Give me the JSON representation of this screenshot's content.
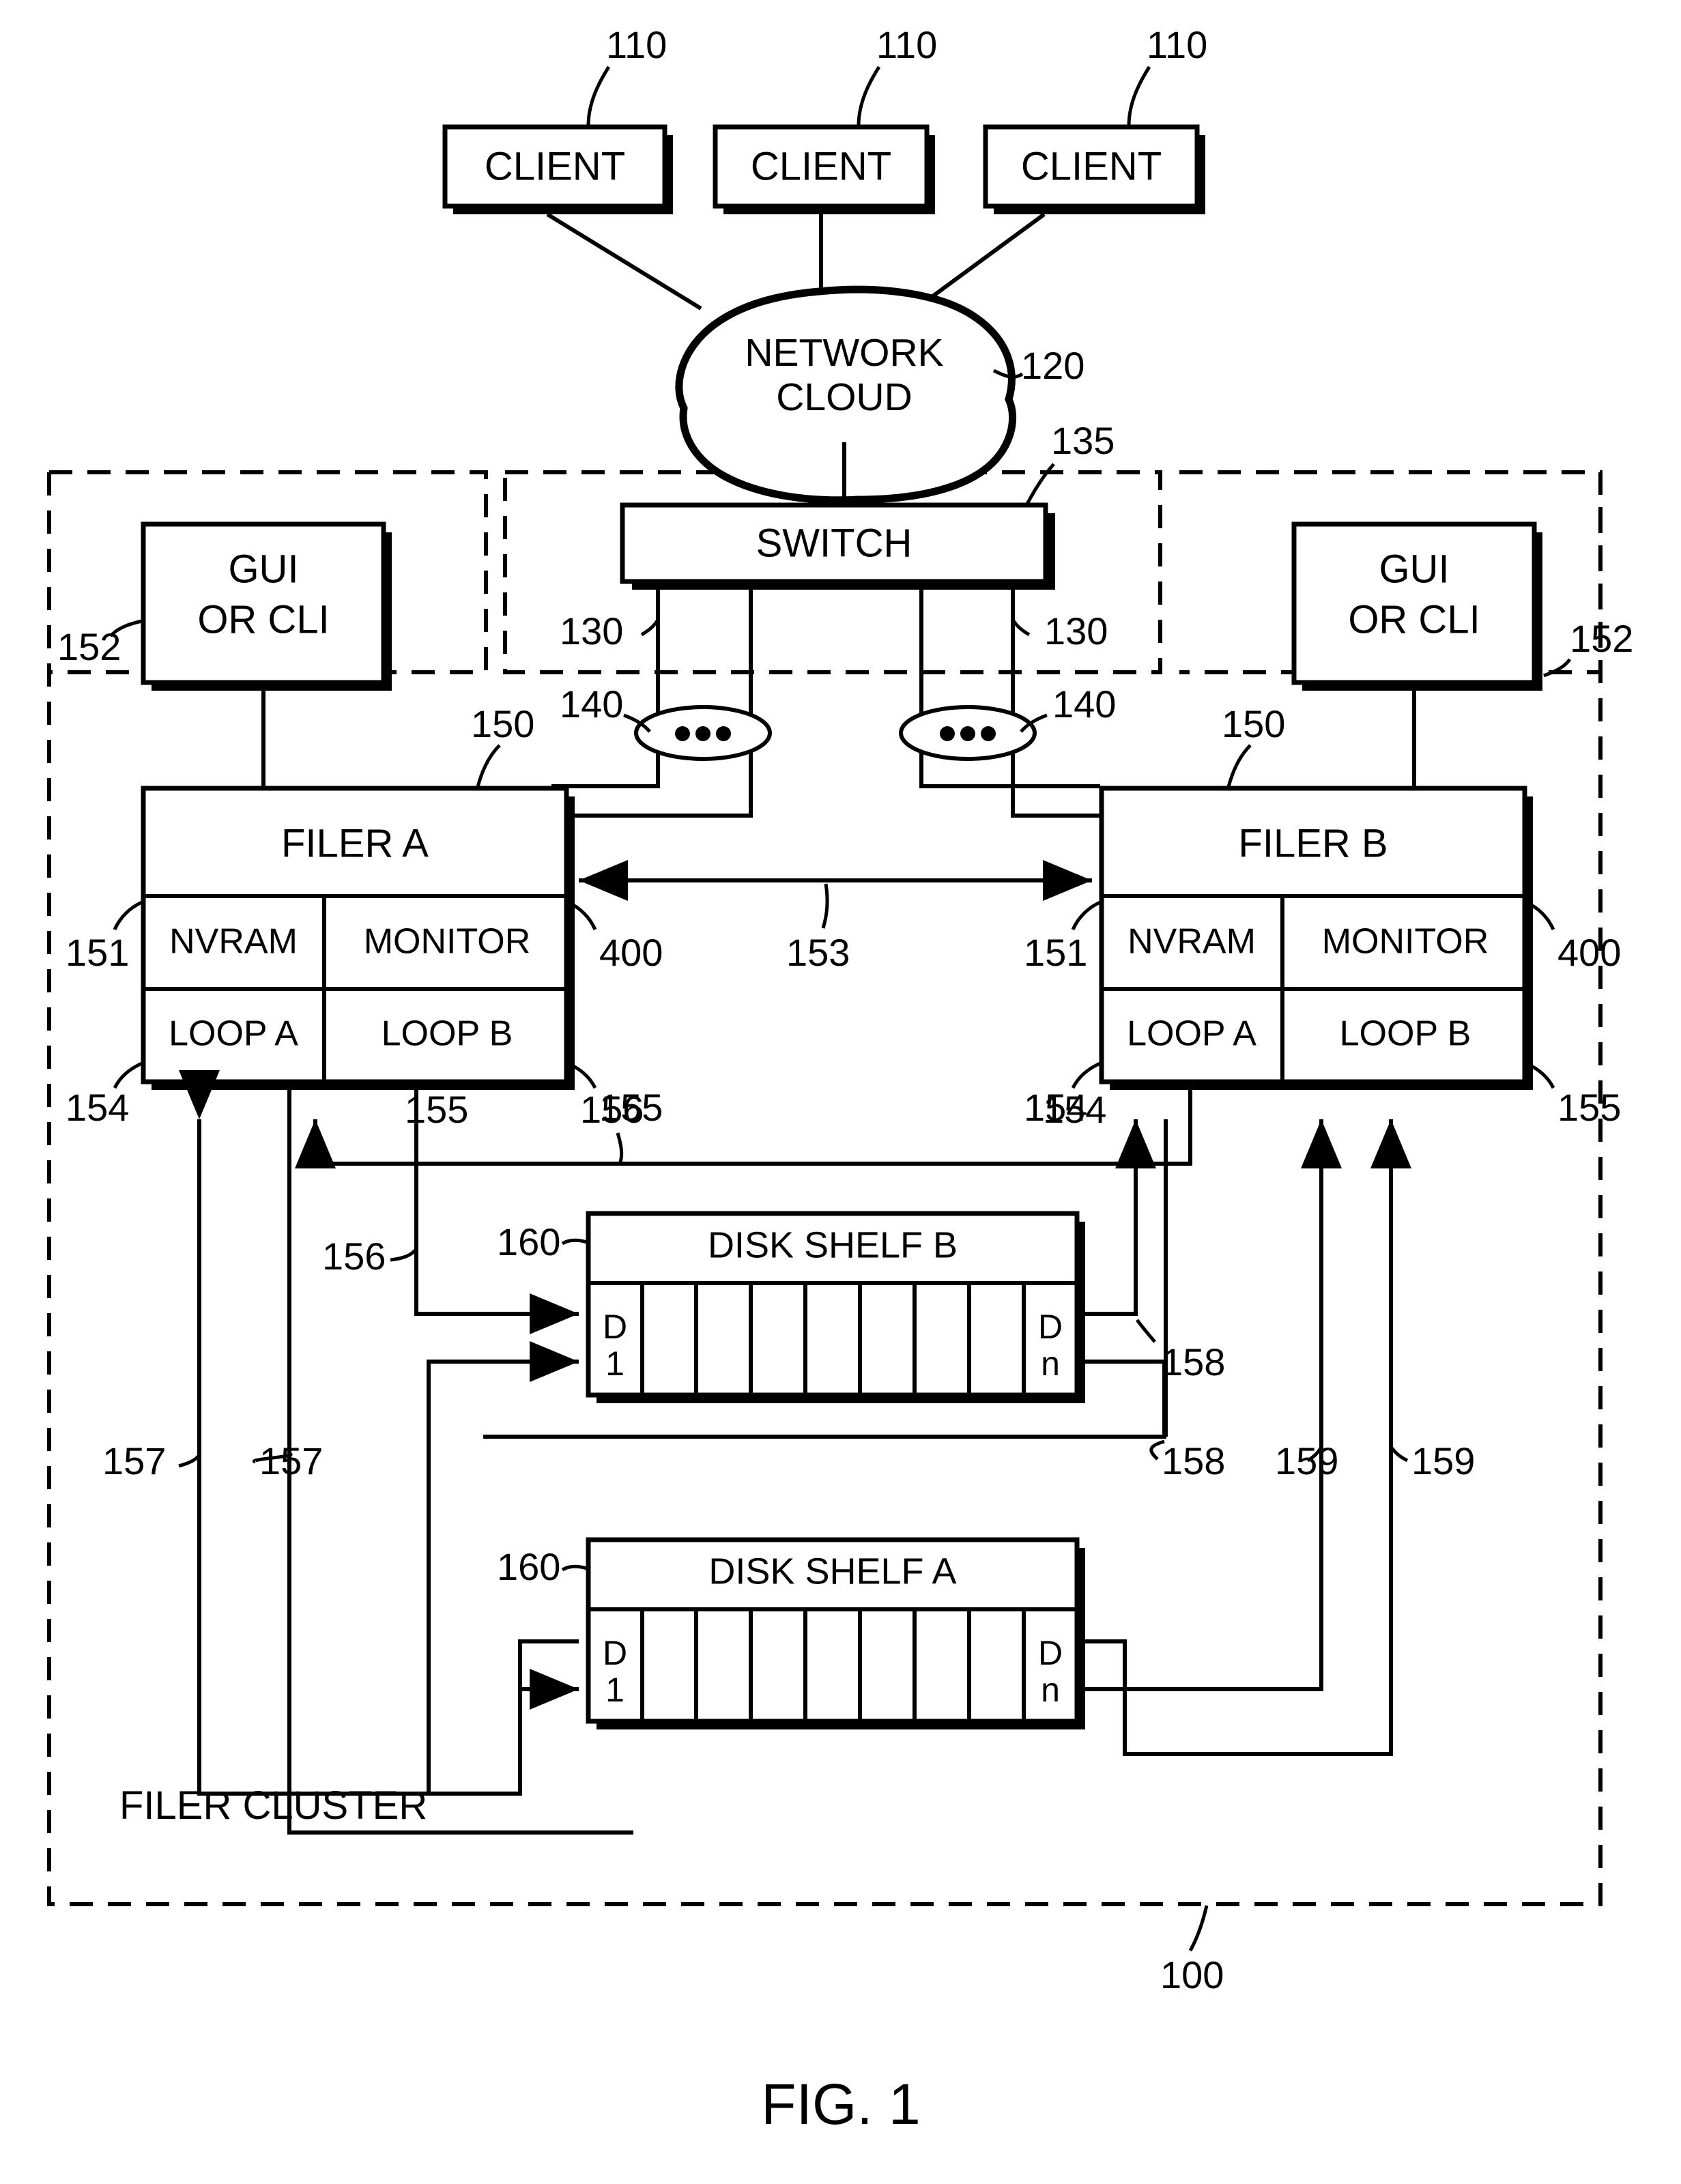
{
  "figure": {
    "caption": "FIG. 1",
    "system_ref": "100",
    "cluster_label": "FILER CLUSTER"
  },
  "clients": [
    {
      "label": "CLIENT",
      "ref": "110"
    },
    {
      "label": "CLIENT",
      "ref": "110"
    },
    {
      "label": "CLIENT",
      "ref": "110"
    }
  ],
  "network": {
    "cloud_line1": "NETWORK",
    "cloud_line2": "CLOUD",
    "cloud_ref": "120",
    "switch_label": "SWITCH",
    "switch_ref": "135",
    "link_ref_left": "130",
    "link_ref_right": "130",
    "ellipsis_ref_left": "140",
    "ellipsis_ref_right": "140"
  },
  "consoles": [
    {
      "line1": "GUI",
      "line2": "OR CLI",
      "ref": "152"
    },
    {
      "line1": "GUI",
      "line2": "OR CLI",
      "ref": "152"
    }
  ],
  "filers": [
    {
      "title": "FILER A",
      "ref": "150",
      "nvram": "NVRAM",
      "monitor": "MONITOR",
      "loop_a": "LOOP A",
      "loop_b": "LOOP B",
      "nvram_ref": "151",
      "monitor_ref": "400",
      "loop_a_ref": "154",
      "loop_b_ref": "155"
    },
    {
      "title": "FILER B",
      "ref": "150",
      "nvram": "NVRAM",
      "monitor": "MONITOR",
      "loop_a": "LOOP A",
      "loop_b": "LOOP B",
      "nvram_ref": "151",
      "monitor_ref": "400",
      "loop_a_ref": "154",
      "loop_b_ref": "155"
    }
  ],
  "interconnect": {
    "ref": "153"
  },
  "disk_shelves": [
    {
      "title": "DISK SHELF B",
      "ref": "160",
      "first_disk_line1": "D",
      "first_disk_line2": "1",
      "last_disk_line1": "D",
      "last_disk_line2": "n",
      "slot_count": 9
    },
    {
      "title": "DISK SHELF A",
      "ref": "160",
      "first_disk_line1": "D",
      "first_disk_line2": "1",
      "last_disk_line1": "D",
      "last_disk_line2": "n",
      "slot_count": 9
    }
  ],
  "loop_refs": {
    "shelfb_in_upper": "156",
    "shelfb_in_lower": "156",
    "shelfb_top": "156",
    "shelfa_in_upper": "157",
    "shelfa_in_lower": "157",
    "shelfb_out_upper": "158",
    "shelfb_out_lower": "158",
    "shelfa_out_upper": "159",
    "shelfa_out_lower": "159"
  }
}
